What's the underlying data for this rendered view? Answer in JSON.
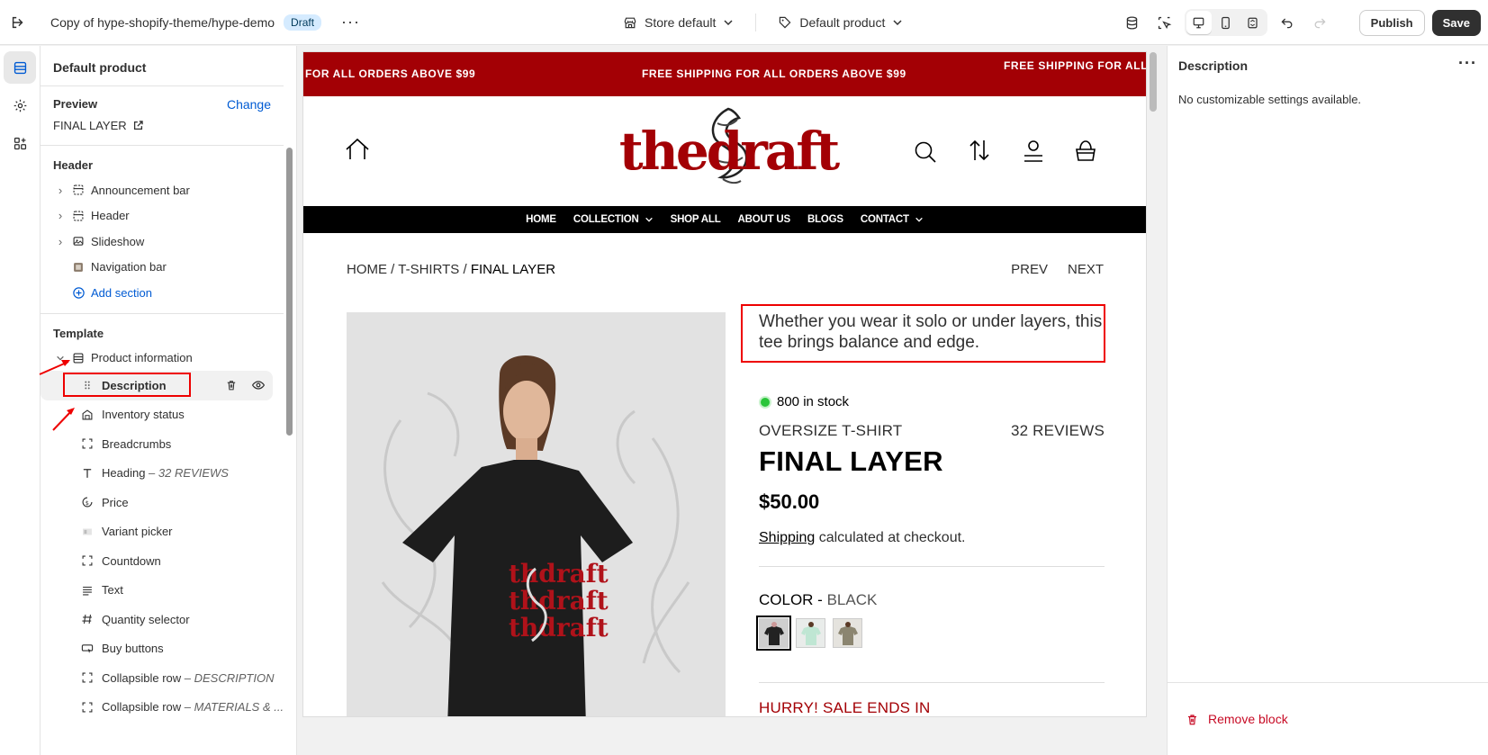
{
  "topbar": {
    "title": "Copy of hype-shopify-theme/hype-demo",
    "status_badge": "Draft",
    "store_selector": "Store default",
    "template_selector": "Default product",
    "publish_label": "Publish",
    "save_label": "Save"
  },
  "left_panel": {
    "title": "Default product",
    "preview_label": "Preview",
    "change_label": "Change",
    "preview_product": "FINAL LAYER",
    "header_group": "Header",
    "header_items": [
      {
        "label": "Announcement bar"
      },
      {
        "label": "Header"
      },
      {
        "label": "Slideshow"
      },
      {
        "label": "Navigation bar"
      }
    ],
    "add_section": "Add section",
    "template_group": "Template",
    "product_information": "Product information",
    "blocks": [
      {
        "label": "Description",
        "sub": ""
      },
      {
        "label": "Inventory status",
        "sub": ""
      },
      {
        "label": "Breadcrumbs",
        "sub": ""
      },
      {
        "label": "Heading",
        "sub": "32 REVIEWS"
      },
      {
        "label": "Price",
        "sub": ""
      },
      {
        "label": "Variant picker",
        "sub": ""
      },
      {
        "label": "Countdown",
        "sub": ""
      },
      {
        "label": "Text",
        "sub": ""
      },
      {
        "label": "Quantity selector",
        "sub": ""
      },
      {
        "label": "Buy buttons",
        "sub": ""
      },
      {
        "label": "Collapsible row",
        "sub": "DESCRIPTION"
      },
      {
        "label": "Collapsible row",
        "sub": "MATERIALS & ..."
      }
    ],
    "dash": " – "
  },
  "store_preview": {
    "announcement": [
      "FOR ALL ORDERS ABOVE $99",
      "FREE SHIPPING FOR ALL ORDERS ABOVE $99",
      "FREE SHIPPING FOR ALL"
    ],
    "logo": "thedraft",
    "nav": [
      "HOME",
      "COLLECTION",
      "SHOP ALL",
      "ABOUT US",
      "BLOGS",
      "CONTACT"
    ],
    "breadcrumb_home": "HOME",
    "breadcrumb_sep": " / ",
    "breadcrumb_cat": "T-SHIRTS",
    "breadcrumb_current": "FINAL LAYER",
    "prev": "PREV",
    "next": "NEXT",
    "description": "Whether you wear it solo or under layers, this tee brings balance and edge.",
    "stock": "800 in stock",
    "subtitle": "OVERSIZE T-SHIRT",
    "reviews": "32 REVIEWS",
    "product_title": "FINAL LAYER",
    "price": "$50.00",
    "shipping_link": "Shipping",
    "shipping_rest": " calculated at checkout.",
    "color_label": "COLOR - ",
    "color_value": "BLACK",
    "hurry": "HURRY! SALE ENDS IN",
    "brand_color": "#a30005"
  },
  "right_panel": {
    "title": "Description",
    "note": "No customizable settings available.",
    "remove": "Remove block"
  }
}
